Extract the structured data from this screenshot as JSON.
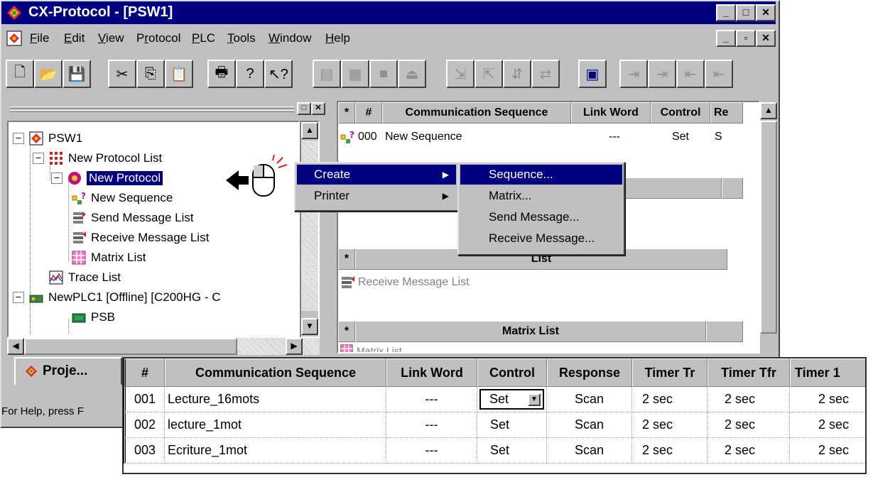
{
  "window": {
    "title": "CX-Protocol - [PSW1]",
    "colors": {
      "titlebar": "#000080",
      "face": "#c0c0c0"
    }
  },
  "menubar": {
    "items": [
      {
        "label": "File",
        "key": "F"
      },
      {
        "label": "Edit",
        "key": "E"
      },
      {
        "label": "View",
        "key": "V"
      },
      {
        "label": "Protocol",
        "key": "r"
      },
      {
        "label": "PLC",
        "key": "P"
      },
      {
        "label": "Tools",
        "key": "T"
      },
      {
        "label": "Window",
        "key": "W"
      },
      {
        "label": "Help",
        "key": "H"
      }
    ]
  },
  "tree": {
    "items": [
      {
        "label": "PSW1",
        "icon": "project-icon"
      },
      {
        "label": "New Protocol List",
        "icon": "protocol-list-icon"
      },
      {
        "label": "New Protocol",
        "icon": "protocol-icon",
        "selected": true
      },
      {
        "label": "New Sequence",
        "icon": "sequence-icon"
      },
      {
        "label": "Send Message List",
        "icon": "send-message-list-icon"
      },
      {
        "label": "Receive Message List",
        "icon": "receive-message-list-icon"
      },
      {
        "label": "Matrix List",
        "icon": "matrix-list-icon"
      },
      {
        "label": "Trace List",
        "icon": "trace-list-icon"
      },
      {
        "label": "NewPLC1 [Offline] [C200HG - C",
        "icon": "plc-icon"
      },
      {
        "label": "PSB",
        "icon": "psb-icon"
      }
    ]
  },
  "project_tab": {
    "label": "Proje..."
  },
  "statusbar": {
    "text": "For Help, press F"
  },
  "right_grid": {
    "headers": [
      "*",
      "#",
      "Communication Sequence",
      "Link Word",
      "Control",
      "Re"
    ],
    "row": {
      "num": "000",
      "name": "New Sequence",
      "link": "---",
      "control": "Set",
      "resp": "S"
    },
    "list_header_partial": "List",
    "receive_row": "Receive Message List",
    "matrix_header": "Matrix List",
    "matrix_row": "Matrix List",
    "star": "*"
  },
  "context_menu": {
    "items": [
      {
        "label": "Create",
        "highlighted": true,
        "submenu": true
      },
      {
        "label": "Printer",
        "highlighted": false,
        "submenu": true
      }
    ]
  },
  "submenu": {
    "items": [
      {
        "label": "Sequence...",
        "highlighted": true
      },
      {
        "label": "Matrix...",
        "highlighted": false
      },
      {
        "label": "Send Message...",
        "highlighted": false
      },
      {
        "label": "Receive Message...",
        "highlighted": false
      }
    ]
  },
  "bottom_grid": {
    "headers": [
      "#",
      "Communication Sequence",
      "Link Word",
      "Control",
      "Response",
      "Timer Tr",
      "Timer Tfr",
      "Timer 1"
    ],
    "rows": [
      {
        "num": "001",
        "name": "Lecture_16mots",
        "link": "---",
        "control": "Set",
        "response": "Scan",
        "t1": "2 sec",
        "t2": "2 sec",
        "t3": "2 sec",
        "dropdown": true
      },
      {
        "num": "002",
        "name": "lecture_1mot",
        "link": "---",
        "control": "Set",
        "response": "Scan",
        "t1": "2 sec",
        "t2": "2 sec",
        "t3": "2 sec",
        "dropdown": false
      },
      {
        "num": "003",
        "name": "Ecriture_1mot",
        "link": "---",
        "control": "Set",
        "response": "Scan",
        "t1": "2 sec",
        "t2": "2 sec",
        "t3": "2 sec",
        "dropdown": false
      }
    ]
  }
}
